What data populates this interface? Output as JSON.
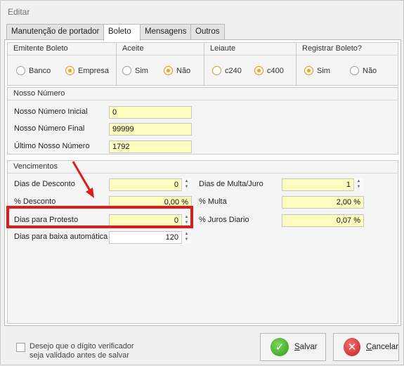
{
  "window": {
    "title": "Editar"
  },
  "tabs": [
    {
      "label": "Manutenção de portador"
    },
    {
      "label": "Boleto"
    },
    {
      "label": "Mensagens"
    },
    {
      "label": "Outros"
    }
  ],
  "emitente": {
    "title": "Emitente Boleto",
    "options": [
      "Banco",
      "Empresa"
    ],
    "selected": "Empresa"
  },
  "aceite": {
    "title": "Aceite",
    "options": [
      "Sim",
      "Não"
    ],
    "selected": "Não"
  },
  "leiaute": {
    "title": "Leiaute",
    "options": [
      "c240",
      "c400"
    ],
    "selected": "c400"
  },
  "registrar": {
    "title": "Registrar Boleto?",
    "options": [
      "Sim",
      "Não"
    ],
    "selected": "Sim"
  },
  "nosso_numero": {
    "title": "Nosso Número",
    "inicial_label": "Nosso Número Inicial",
    "inicial_value": "0",
    "final_label": "Nosso Número Final",
    "final_value": "99999",
    "ultimo_label": "Último Nosso Número",
    "ultimo_value": "1792"
  },
  "vencimentos": {
    "title": "Vencimentos",
    "dias_desconto_label": "Dias de Desconto",
    "dias_desconto_value": "0",
    "pct_desconto_label": "% Desconto",
    "pct_desconto_value": "0,00 %",
    "dias_protesto_label": "Dias para Protesto",
    "dias_protesto_value": "0",
    "dias_baixa_label": "Dias para baixa automática",
    "dias_baixa_value": "120",
    "dias_multa_label": "Dias de Multa/Juro",
    "dias_multa_value": "1",
    "pct_multa_label": "% Multa",
    "pct_multa_value": "2,00 %",
    "pct_juros_label": "% Juros Diario",
    "pct_juros_value": "0,07 %"
  },
  "footer": {
    "checkbox_line1": "Desejo que o dígito verificador",
    "checkbox_line2": "seja validado antes de salvar",
    "save_label": "Salvar",
    "cancel_label": "Cancelar"
  },
  "colors": {
    "highlight": "#e01b1b",
    "input_bg": "#fefdc0",
    "radio_accent": "#e5a43a"
  }
}
